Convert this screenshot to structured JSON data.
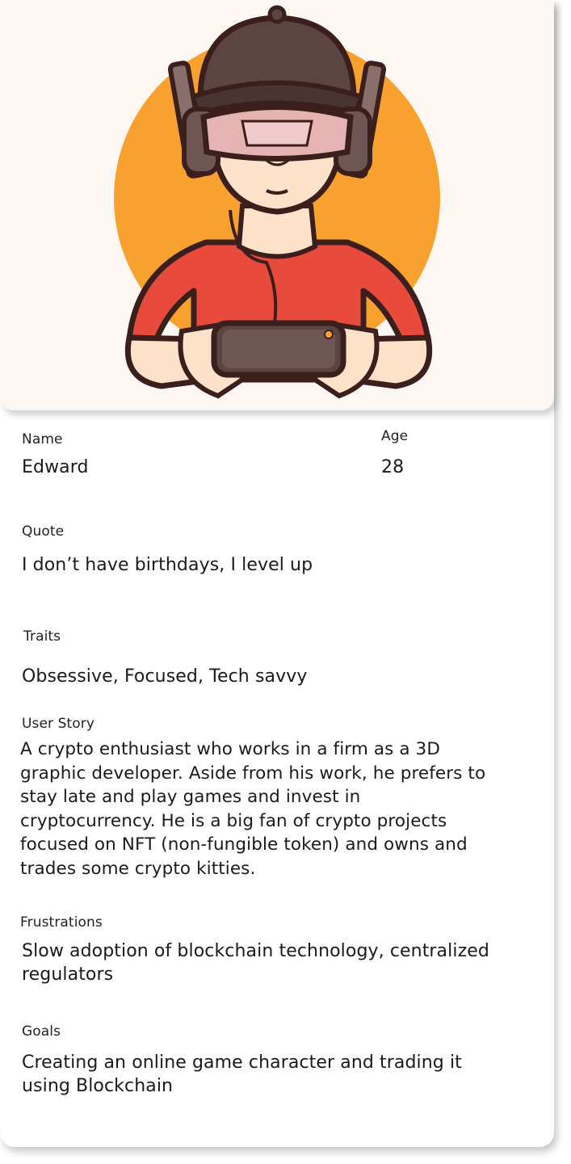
{
  "persona": {
    "illustration_icon": "vr-gamer-avatar-icon",
    "fields": {
      "name": {
        "label": "Name",
        "value": "Edward"
      },
      "age": {
        "label": "Age",
        "value": "28"
      },
      "quote": {
        "label": "Quote",
        "value": "I don’t have birthdays, I level up"
      },
      "traits": {
        "label": "Traits",
        "value": "Obsessive, Focused, Tech savvy"
      },
      "user_story": {
        "label": "User Story",
        "lines": [
          "A crypto enthusiast who works in a firm as a 3D",
          "graphic developer. Aside from his work, he prefers to",
          "stay late and play games and invest in",
          "cryptocurrency. He is a big fan of crypto projects",
          "focused on NFT (non-fungible token) and owns and",
          "trades some crypto kitties."
        ]
      },
      "frustrations": {
        "label": "Frustrations",
        "lines": [
          "Slow adoption of blockchain technology, centralized",
          "regulators"
        ]
      },
      "goals": {
        "label": "Goals",
        "lines": [
          "Creating an online game character and trading it",
          "using Blockchain"
        ]
      }
    }
  },
  "colors": {
    "hero_bg": "#fdf7f3",
    "sun": "#f9a12e",
    "shirt": "#e84a3c",
    "outline": "#3a1f1c",
    "skin": "#fde2c9",
    "cap": "#5b4442",
    "visor": "#e6b3b3"
  }
}
